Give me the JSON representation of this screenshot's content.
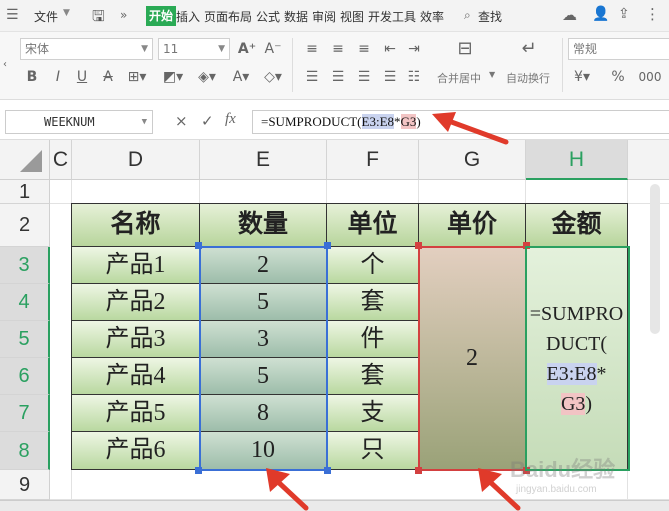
{
  "menu": {
    "file_label": "文件",
    "tabs": [
      "开始",
      "插入",
      "页面布局",
      "公式",
      "数据",
      "审阅",
      "视图",
      "开发工具",
      "效率"
    ],
    "search_label": "查找"
  },
  "ribbon": {
    "font_name": "宋体",
    "font_size": "11",
    "format_value": "常规",
    "merge_label": "合并居中",
    "wrap_label": "自动换行",
    "bold": "B",
    "italic": "I",
    "underline": "U",
    "percent": "%",
    "decimals": "000"
  },
  "formula_bar": {
    "name_box": "WEEKNUM",
    "fx": "fx",
    "cancel": "×",
    "confirm": "✓",
    "prefix": "=SUMPRODUCT(",
    "ref1": "E3:E8",
    "op": "*",
    "ref2": "G3",
    "suffix": ")"
  },
  "grid": {
    "columns": [
      "C",
      "D",
      "E",
      "F",
      "G",
      "H"
    ],
    "rows": [
      "1",
      "2",
      "3",
      "4",
      "5",
      "6",
      "7",
      "8",
      "9"
    ],
    "headers": [
      "名称",
      "数量",
      "单位",
      "单价",
      "金额"
    ],
    "items": [
      {
        "name": "产品1",
        "qty": "2",
        "unit": "个"
      },
      {
        "name": "产品2",
        "qty": "5",
        "unit": "套"
      },
      {
        "name": "产品3",
        "qty": "3",
        "unit": "件"
      },
      {
        "name": "产品4",
        "qty": "5",
        "unit": "套"
      },
      {
        "name": "产品5",
        "qty": "8",
        "unit": "支"
      },
      {
        "name": "产品6",
        "qty": "10",
        "unit": "只"
      }
    ],
    "price": "2",
    "formula_lines": [
      "=SUMPRO",
      "DUCT(",
      "E3:E8",
      "*",
      "G3",
      ")"
    ]
  },
  "colors": {
    "accent": "#2aa060",
    "arrow": "#e03a2a",
    "ref_blue": "#c9d3ef",
    "ref_red": "#f2c4c4"
  },
  "watermark": {
    "text": "Baidu经验",
    "sub": "jingyan.baidu.com"
  }
}
